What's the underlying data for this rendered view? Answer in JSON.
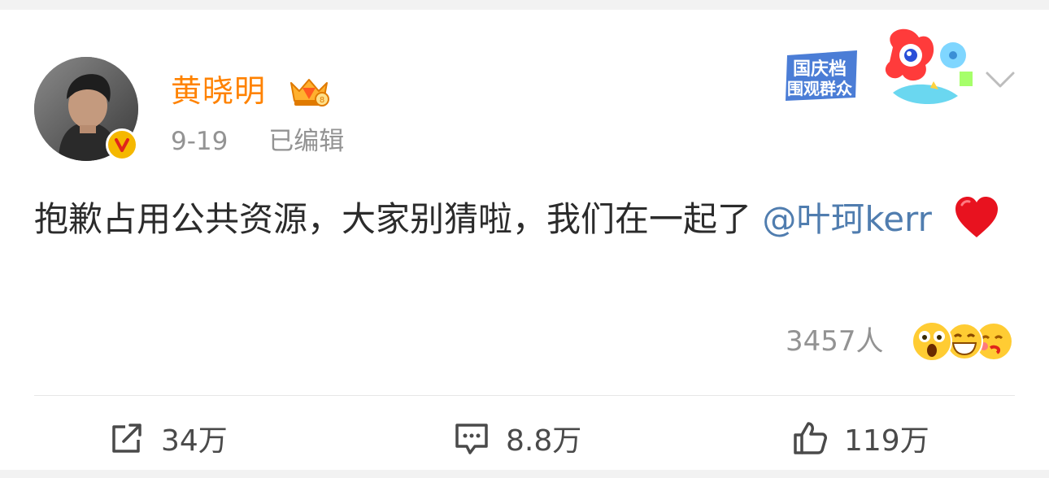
{
  "post": {
    "author_name": "黄晓明",
    "date": "9-19",
    "edited_label": "已编辑",
    "text": "抱歉占用公共资源，大家别猜啦，我们在一起了",
    "mention": "@叶珂kerr",
    "emoji": "heart",
    "sticker_text_line1": "国庆档",
    "sticker_text_line2": "围观群众"
  },
  "reactions": {
    "count_label": "3457人",
    "emoji_icons": [
      "surprised-face-icon",
      "grinning-face-icon",
      "kissing-face-icon"
    ]
  },
  "actions": {
    "repost_count": "34万",
    "comment_count": "8.8万",
    "like_count": "119万"
  },
  "colors": {
    "author_name": "#ff8200",
    "mention": "#507daf",
    "meta_text": "#939393",
    "verified_badge": "#f5b800"
  }
}
